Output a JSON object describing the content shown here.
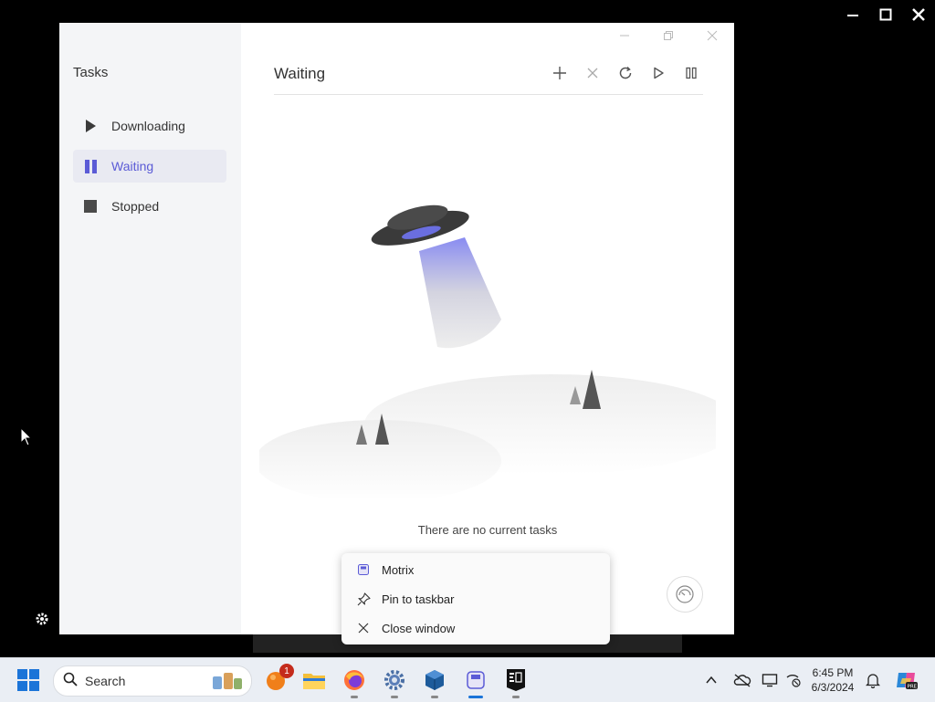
{
  "sidebar": {
    "title": "Tasks",
    "items": [
      {
        "label": "Downloading",
        "icon": "play-icon"
      },
      {
        "label": "Waiting",
        "icon": "pause-icon",
        "active": true
      },
      {
        "label": "Stopped",
        "icon": "stop-icon"
      }
    ]
  },
  "main": {
    "title": "Waiting",
    "toolbar": [
      "add-task-icon",
      "delete-icon",
      "refresh-icon",
      "resume-all-icon",
      "pause-all-icon"
    ],
    "empty_message": "There are no current tasks"
  },
  "jump_list": {
    "items": [
      {
        "label": "Motrix",
        "icon": "motrix-icon"
      },
      {
        "label": "Pin to taskbar",
        "icon": "pin-icon"
      },
      {
        "label": "Close window",
        "icon": "close-icon"
      }
    ]
  },
  "taskbar": {
    "search_label": "Search",
    "notification_count": "1",
    "time": "6:45 PM",
    "date": "6/3/2024"
  },
  "colors": {
    "accent": "#5b5bd6",
    "sidebar_bg": "#f4f5f7",
    "taskbar_bg": "#eaeef4"
  }
}
